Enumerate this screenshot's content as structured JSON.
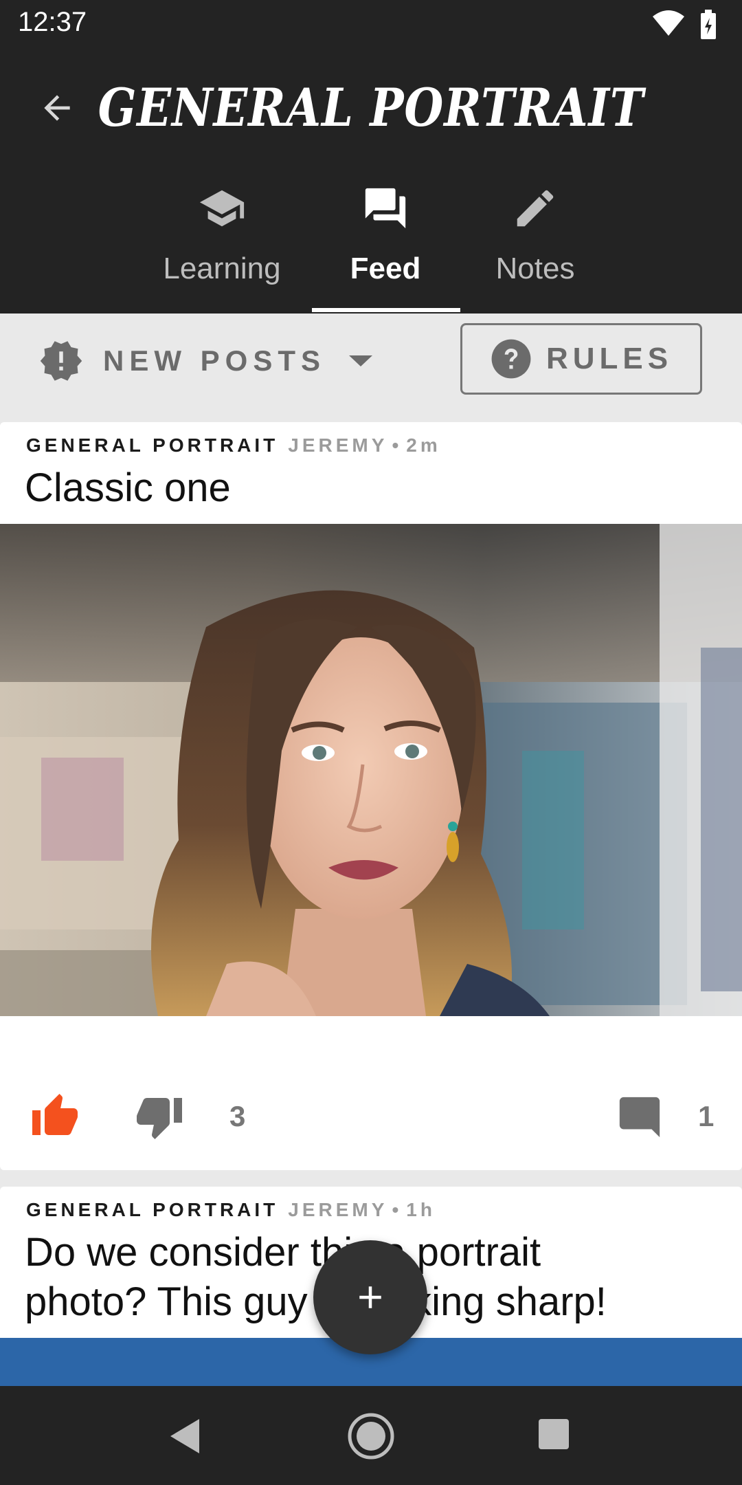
{
  "status_bar": {
    "time": "12:37"
  },
  "header": {
    "title": "General Portrait"
  },
  "tabs": [
    {
      "label": "Learning",
      "icon": "school-icon",
      "active": false
    },
    {
      "label": "Feed",
      "icon": "forum-icon",
      "active": true
    },
    {
      "label": "Notes",
      "icon": "pencil-icon",
      "active": false
    }
  ],
  "filter": {
    "sort_label": "NEW POSTS",
    "rules_label": "RULES"
  },
  "posts": [
    {
      "community": "GENERAL PORTRAIT",
      "author": "JEREMY",
      "time": "2m",
      "title": "Classic one",
      "score": "3",
      "comments": "1",
      "liked": true
    },
    {
      "community": "GENERAL PORTRAIT",
      "author": "JEREMY",
      "time": "1h",
      "title_line1": "Do we consider this a portrait",
      "title_line2": "photo? This guy is looking sharp!"
    }
  ],
  "colors": {
    "accent": "#f4511e",
    "bar": "#232323",
    "fab": "#323232"
  }
}
